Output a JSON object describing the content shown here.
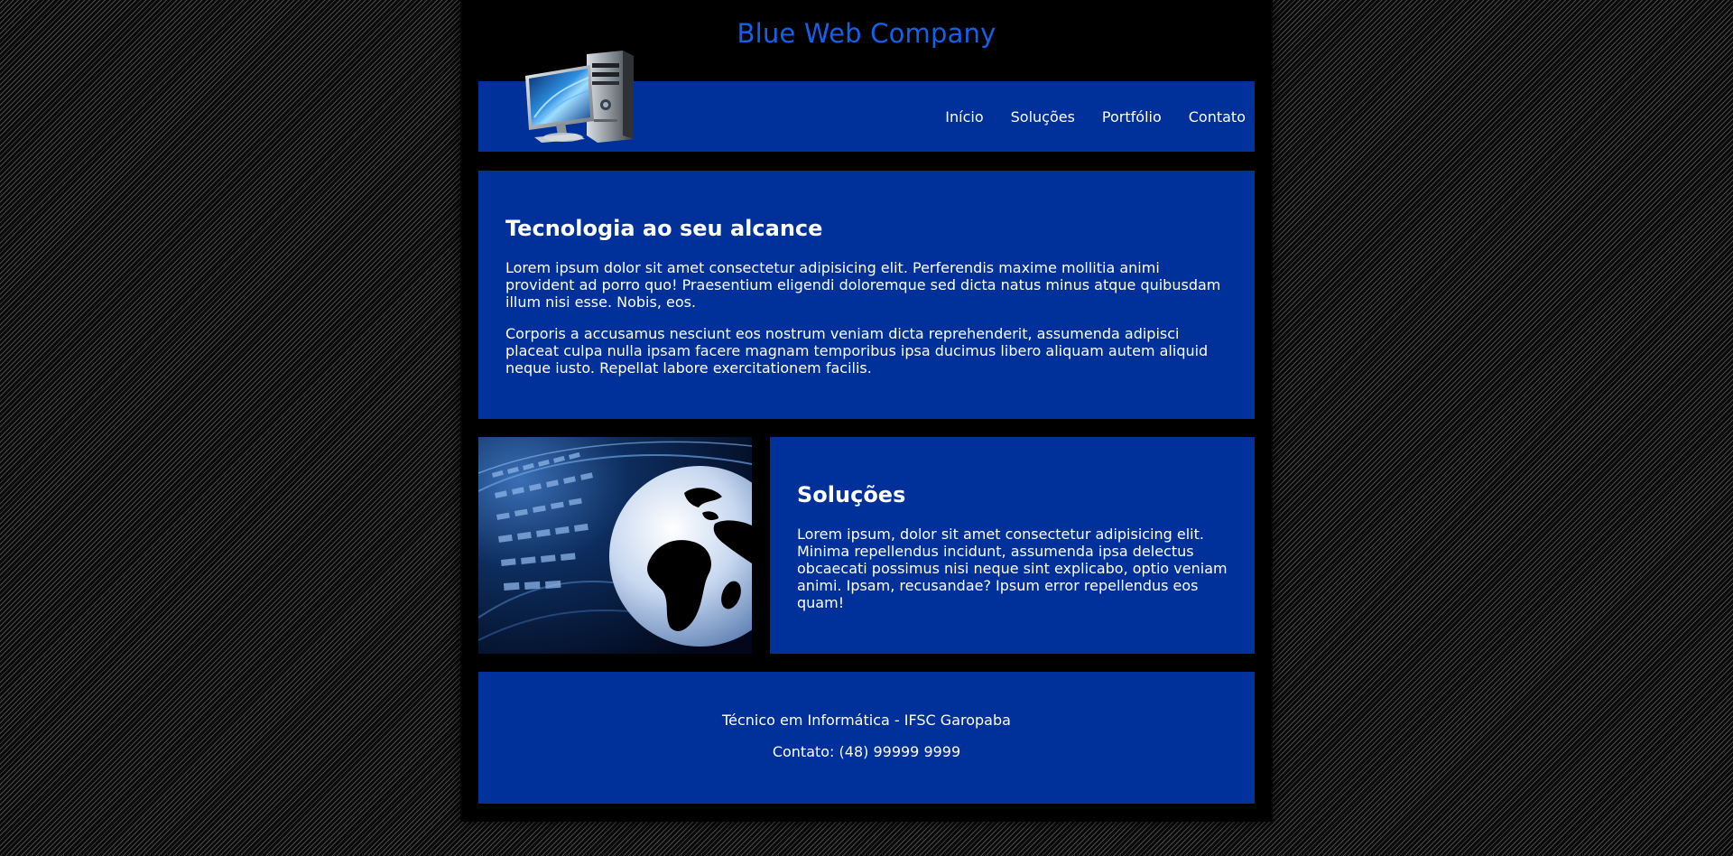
{
  "header": {
    "title": "Blue Web Company",
    "logo_icon": "desktop-computer-icon"
  },
  "nav": {
    "items": [
      {
        "label": "Início"
      },
      {
        "label": "Soluções"
      },
      {
        "label": "Portfólio"
      },
      {
        "label": "Contato"
      }
    ]
  },
  "hero": {
    "heading": "Tecnologia ao seu alcance",
    "paragraphs": [
      "Lorem ipsum dolor sit amet consectetur adipisicing elit. Perferendis maxime mollitia animi provident ad porro quo! Praesentium eligendi doloremque sed dicta natus minus atque quibusdam illum nisi esse. Nobis, eos.",
      "Corporis a accusamus nesciunt eos nostrum veniam dicta reprehenderit, assumenda adipisci placeat culpa nulla ipsam facere magnam temporibus ipsa ducimus libero aliquam autem aliquid neque iusto. Repellat labore exercitationem facilis."
    ]
  },
  "solutions": {
    "image_icon": "globe-keyboard-image",
    "heading": "Soluções",
    "text": "Lorem ipsum, dolor sit amet consectetur adipisicing elit. Minima repellendus incidunt, assumenda ipsa delectus obcaecati possimus nisi neque sint explicabo, optio veniam animi. Ipsam, recusandae? Ipsum error repellendus eos quam!"
  },
  "footer": {
    "line1": "Técnico em Informática - IFSC Garopaba",
    "line2": "Contato: (48) 99999 9999"
  },
  "colors": {
    "accent_title": "#1560e8",
    "panel_blue": "#00309a",
    "page_bg": "#000000"
  }
}
